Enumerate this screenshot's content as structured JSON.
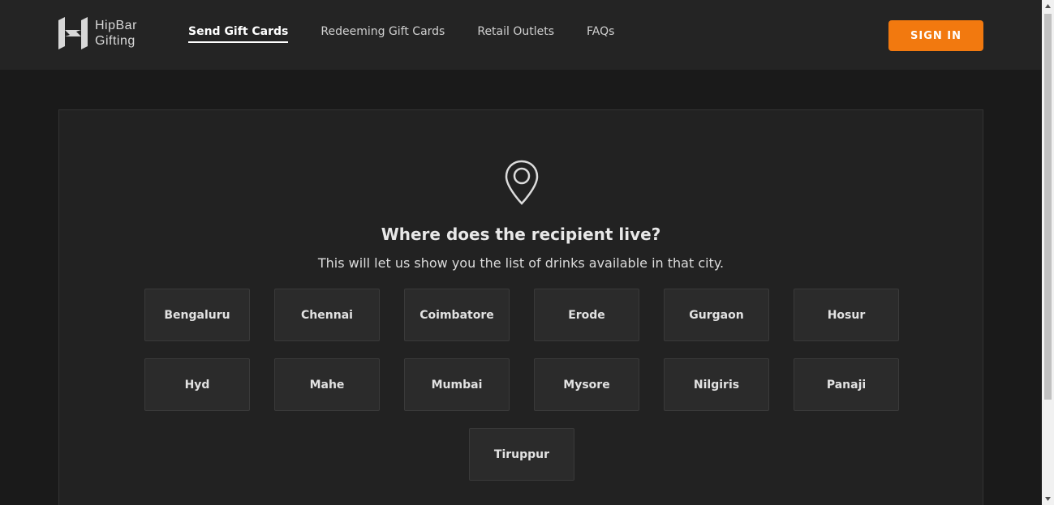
{
  "brand": {
    "line1": "HipBar",
    "line2": "Gifting"
  },
  "nav": [
    {
      "label": "Send Gift Cards",
      "active": true
    },
    {
      "label": "Redeeming Gift Cards",
      "active": false
    },
    {
      "label": "Retail Outlets",
      "active": false
    },
    {
      "label": "FAQs",
      "active": false
    }
  ],
  "signin_label": "SIGN IN",
  "main": {
    "question": "Where does the recipient live?",
    "subtitle": "This will let us show you the list of drinks available in that city.",
    "cities": [
      "Bengaluru",
      "Chennai",
      "Coimbatore",
      "Erode",
      "Gurgaon",
      "Hosur",
      "Hyd",
      "Mahe",
      "Mumbai",
      "Mysore",
      "Nilgiris",
      "Panaji",
      "Tiruppur"
    ]
  },
  "colors": {
    "accent": "#f2790f",
    "background": "#1a1a1a",
    "panel": "#222222",
    "header": "#242424"
  }
}
